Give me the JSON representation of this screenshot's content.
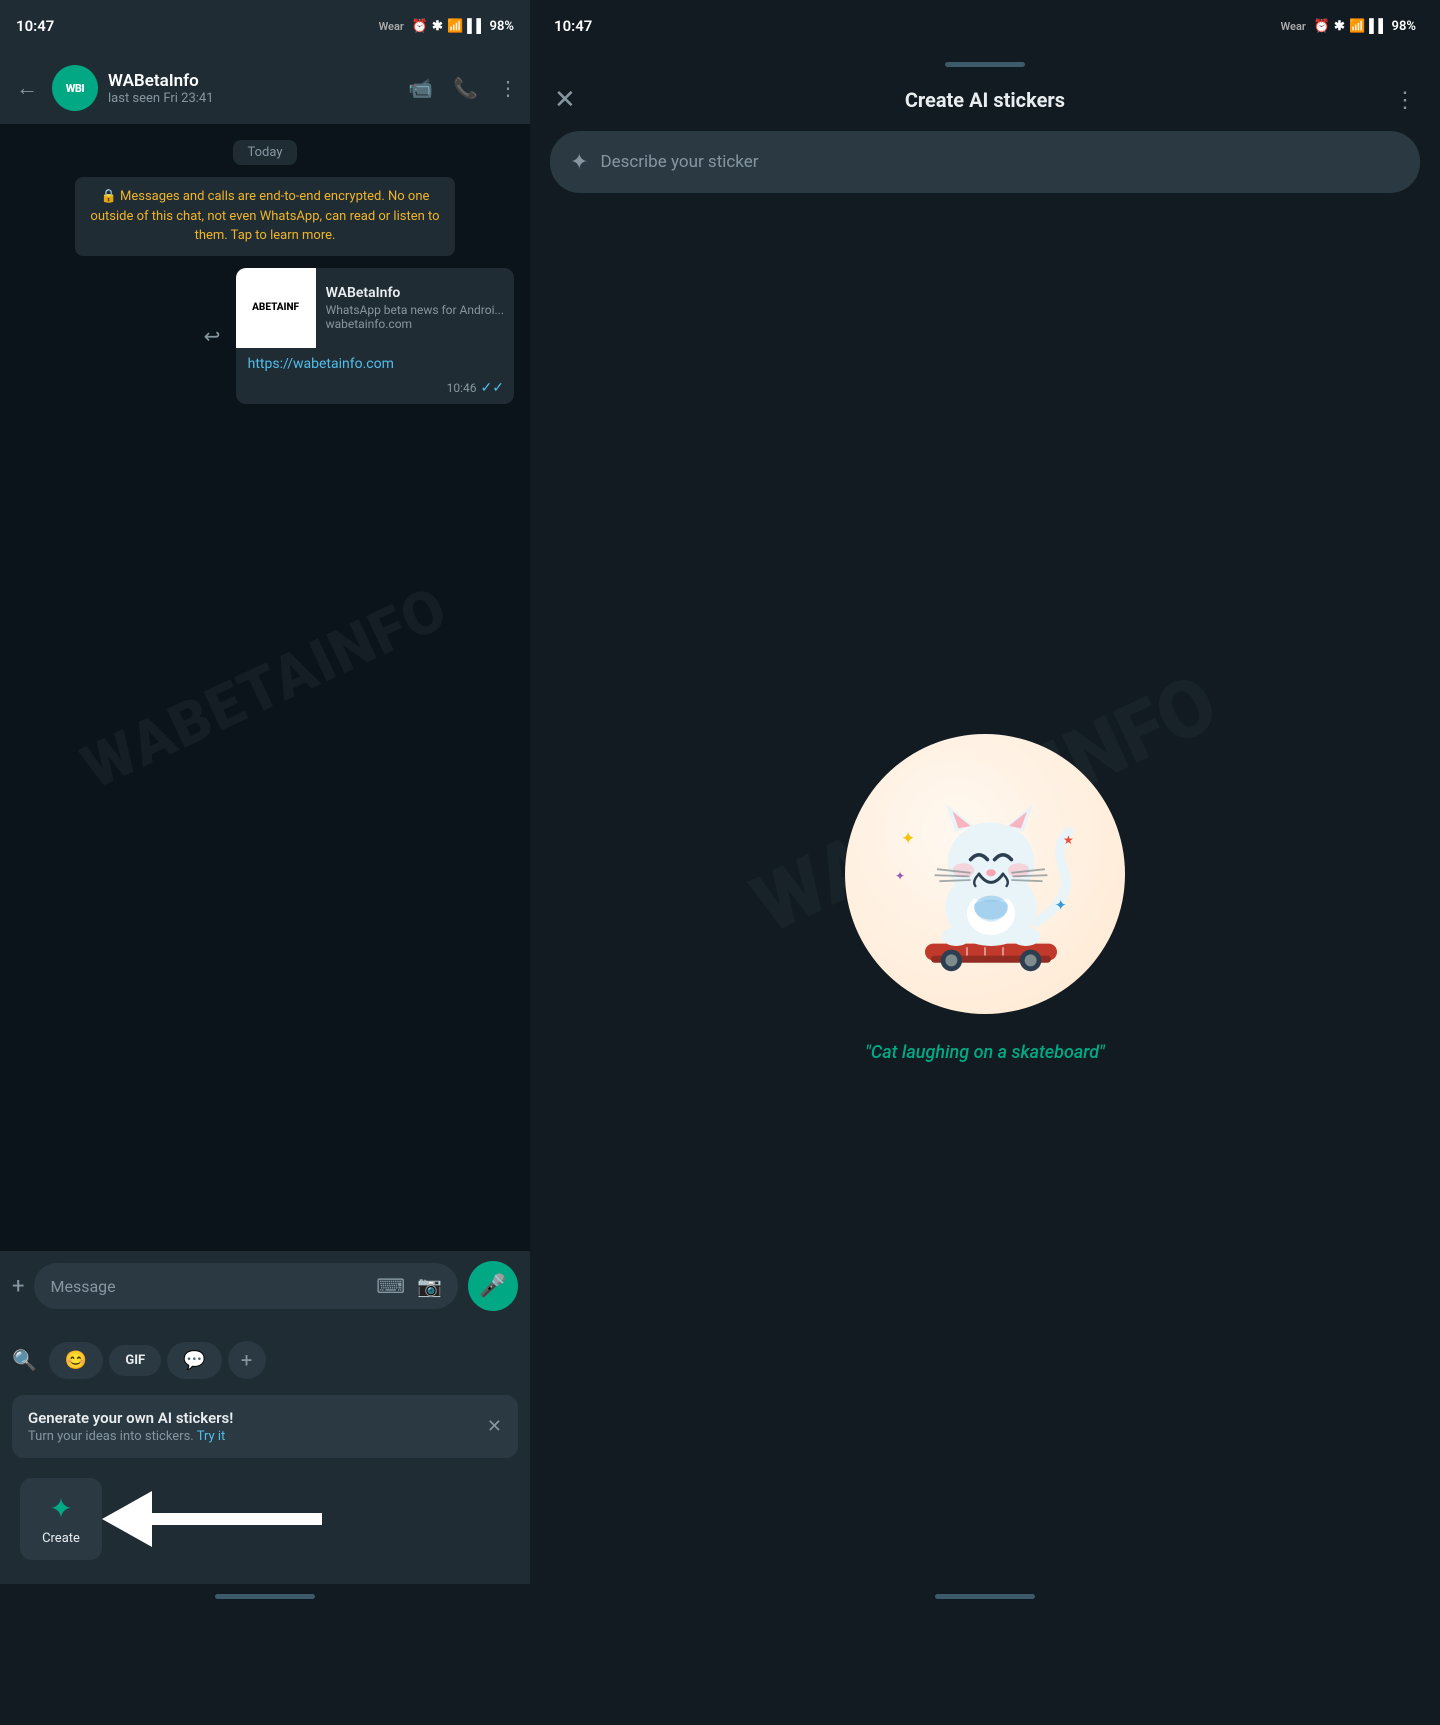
{
  "left": {
    "statusBar": {
      "time": "10:47",
      "wearLabel": "Wear",
      "battery": "98%"
    },
    "header": {
      "backIcon": "←",
      "avatarText": "WBI",
      "contactName": "WABetaInfo",
      "contactStatus": "last seen Fri 23:41",
      "videoIcon": "🎥",
      "callIcon": "📞",
      "moreIcon": "⋮"
    },
    "chat": {
      "dateDivider": "Today",
      "systemMessage": "🔒 Messages and calls are end-to-end encrypted. No one outside of this chat, not even WhatsApp, can read or listen to them. Tap to learn more.",
      "linkCard": {
        "imageText": "ABETAINF",
        "title": "WABetaInfo",
        "description": "WhatsApp beta news for Androi...",
        "domain": "wabetainfo.com",
        "url": "https://wabetainfo.com",
        "time": "10:46",
        "checkIcon": "✓✓"
      }
    },
    "inputArea": {
      "plusIcon": "+",
      "placeholder": "Message",
      "keyboardIcon": "⌨",
      "cameraIcon": "📷",
      "micIcon": "🎤"
    },
    "pickerArea": {
      "searchIcon": "🔍",
      "tabs": [
        {
          "icon": "😊",
          "label": ""
        },
        {
          "icon": "GIF",
          "label": ""
        },
        {
          "icon": "💬",
          "label": ""
        }
      ],
      "plusTab": "+"
    },
    "aiPromo": {
      "title": "Generate your own AI stickers!",
      "subtitle": "Turn your ideas into stickers.",
      "tryLabel": "Try it",
      "closeIcon": "✕"
    },
    "createArea": {
      "icon": "✦",
      "label": "Create"
    },
    "arrowVisible": true,
    "homeIndicator": true
  },
  "right": {
    "statusBar": {
      "time": "10:47",
      "wearLabel": "Wear",
      "battery": "98%"
    },
    "sheetHandle": true,
    "header": {
      "closeIcon": "✕",
      "title": "Create AI stickers",
      "moreIcon": "⋮"
    },
    "describeInput": {
      "sparkleIcon": "✦",
      "placeholder": "Describe your sticker"
    },
    "stickerCaption": "\"Cat laughing on a skateboard\"",
    "watermark": "WABETAINFO",
    "homeIndicator": true
  }
}
